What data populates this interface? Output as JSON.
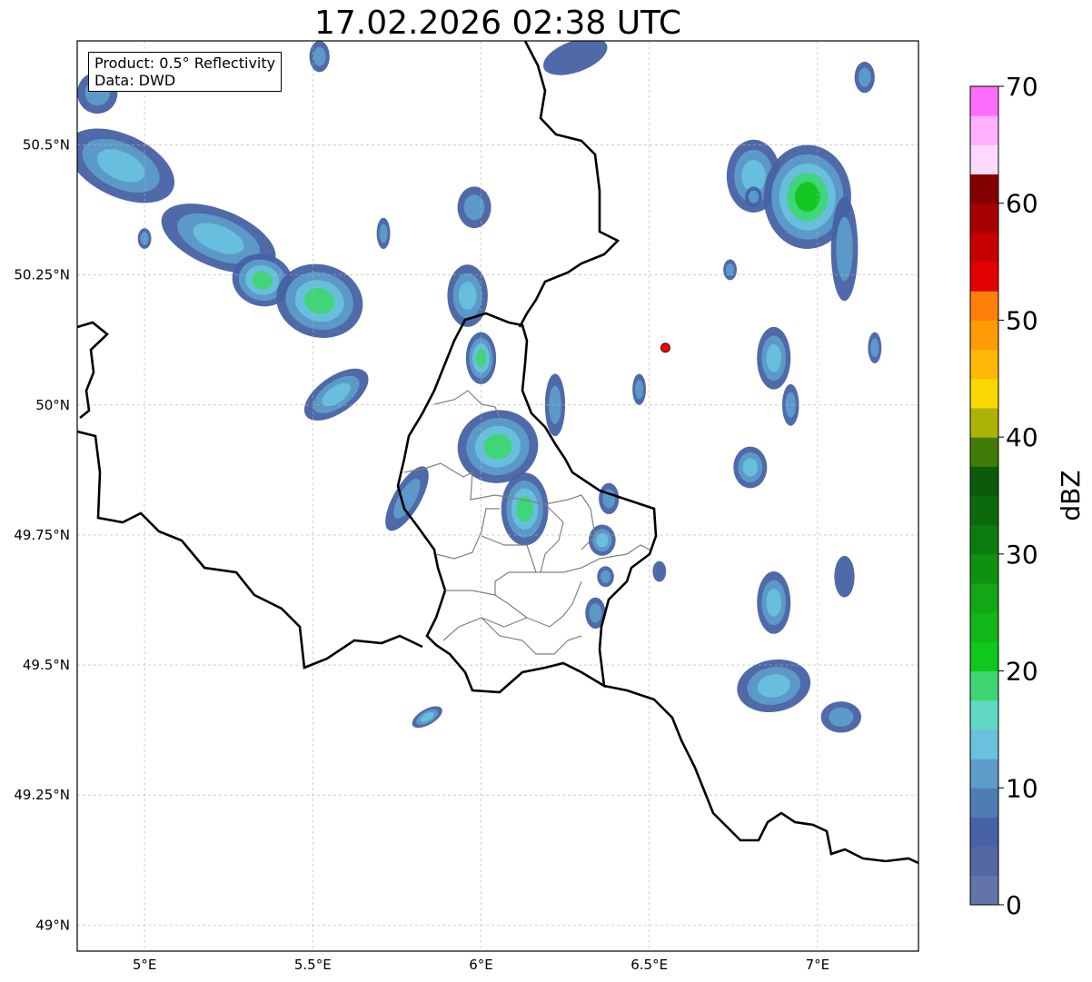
{
  "title": "17.02.2026 02:38 UTC",
  "info_box": {
    "product": "Product: 0.5° Reflectivity",
    "data": "Data: DWD"
  },
  "map": {
    "lon_range": [
      4.8,
      7.3
    ],
    "lat_range": [
      48.95,
      50.7
    ],
    "lon_ticks": [
      {
        "value": 5.0,
        "label": "5°E"
      },
      {
        "value": 5.5,
        "label": "5.5°E"
      },
      {
        "value": 6.0,
        "label": "6°E"
      },
      {
        "value": 6.5,
        "label": "6.5°E"
      },
      {
        "value": 7.0,
        "label": "7°E"
      }
    ],
    "lat_ticks": [
      {
        "value": 50.5,
        "label": "50.5°N"
      },
      {
        "value": 50.25,
        "label": "50.25°N"
      },
      {
        "value": 50.0,
        "label": "50°N"
      },
      {
        "value": 49.75,
        "label": "49.75°N"
      },
      {
        "value": 49.5,
        "label": "49.5°N"
      },
      {
        "value": 49.25,
        "label": "49.25°N"
      },
      {
        "value": 49.0,
        "label": "49°N"
      }
    ],
    "gridlines": true,
    "radar_site": {
      "lon": 6.548,
      "lat": 50.11,
      "color": "#ff0000"
    },
    "precip_cells": [
      {
        "lon": 4.93,
        "lat": 50.46,
        "rx": 0.17,
        "ry": 0.06,
        "rot": 25,
        "dbz": 14
      },
      {
        "lon": 5.22,
        "lat": 50.32,
        "rx": 0.18,
        "ry": 0.055,
        "rot": 22,
        "dbz": 15
      },
      {
        "lon": 5.35,
        "lat": 50.24,
        "rx": 0.09,
        "ry": 0.05,
        "rot": 15,
        "dbz": 19
      },
      {
        "lon": 5.52,
        "lat": 50.2,
        "rx": 0.13,
        "ry": 0.07,
        "rot": 15,
        "dbz": 20
      },
      {
        "lon": 5.57,
        "lat": 50.02,
        "rx": 0.11,
        "ry": 0.035,
        "rot": -35,
        "dbz": 17
      },
      {
        "lon": 5.0,
        "lat": 50.32,
        "rx": 0.02,
        "ry": 0.02,
        "rot": 0,
        "dbz": 10
      },
      {
        "lon": 5.71,
        "lat": 50.33,
        "rx": 0.02,
        "ry": 0.03,
        "rot": 0,
        "dbz": 11
      },
      {
        "lon": 5.98,
        "lat": 50.38,
        "rx": 0.05,
        "ry": 0.04,
        "rot": 0,
        "dbz": 13
      },
      {
        "lon": 5.96,
        "lat": 50.21,
        "rx": 0.06,
        "ry": 0.06,
        "rot": 0,
        "dbz": 15
      },
      {
        "lon": 6.0,
        "lat": 50.09,
        "rx": 0.045,
        "ry": 0.05,
        "rot": 0,
        "dbz": 21
      },
      {
        "lon": 6.05,
        "lat": 49.92,
        "rx": 0.12,
        "ry": 0.07,
        "rot": -10,
        "dbz": 19
      },
      {
        "lon": 6.13,
        "lat": 49.8,
        "rx": 0.07,
        "ry": 0.07,
        "rot": 0,
        "dbz": 20
      },
      {
        "lon": 5.78,
        "lat": 49.82,
        "rx": 0.04,
        "ry": 0.07,
        "rot": 30,
        "dbz": 10
      },
      {
        "lon": 6.22,
        "lat": 50.0,
        "rx": 0.03,
        "ry": 0.06,
        "rot": 0,
        "dbz": 11
      },
      {
        "lon": 6.38,
        "lat": 49.82,
        "rx": 0.03,
        "ry": 0.03,
        "rot": 0,
        "dbz": 12
      },
      {
        "lon": 6.36,
        "lat": 49.74,
        "rx": 0.04,
        "ry": 0.03,
        "rot": 0,
        "dbz": 16
      },
      {
        "lon": 6.34,
        "lat": 49.6,
        "rx": 0.03,
        "ry": 0.03,
        "rot": 0,
        "dbz": 10
      },
      {
        "lon": 6.37,
        "lat": 49.67,
        "rx": 0.025,
        "ry": 0.02,
        "rot": 0,
        "dbz": 10
      },
      {
        "lon": 6.28,
        "lat": 50.67,
        "rx": 0.1,
        "ry": 0.03,
        "rot": -20,
        "dbz": 9
      },
      {
        "lon": 5.52,
        "lat": 50.67,
        "rx": 0.03,
        "ry": 0.03,
        "rot": 0,
        "dbz": 10
      },
      {
        "lon": 6.81,
        "lat": 50.44,
        "rx": 0.08,
        "ry": 0.07,
        "rot": 0,
        "dbz": 15
      },
      {
        "lon": 6.97,
        "lat": 50.4,
        "rx": 0.13,
        "ry": 0.1,
        "rot": 0,
        "dbz": 24
      },
      {
        "lon": 7.08,
        "lat": 50.3,
        "rx": 0.04,
        "ry": 0.1,
        "rot": 0,
        "dbz": 12
      },
      {
        "lon": 6.87,
        "lat": 50.09,
        "rx": 0.05,
        "ry": 0.06,
        "rot": 0,
        "dbz": 16
      },
      {
        "lon": 6.92,
        "lat": 50.0,
        "rx": 0.025,
        "ry": 0.04,
        "rot": 0,
        "dbz": 10
      },
      {
        "lon": 6.8,
        "lat": 49.88,
        "rx": 0.05,
        "ry": 0.04,
        "rot": 0,
        "dbz": 16
      },
      {
        "lon": 6.87,
        "lat": 49.62,
        "rx": 0.05,
        "ry": 0.06,
        "rot": 0,
        "dbz": 14
      },
      {
        "lon": 6.87,
        "lat": 49.46,
        "rx": 0.11,
        "ry": 0.05,
        "rot": -10,
        "dbz": 15
      },
      {
        "lon": 7.07,
        "lat": 49.4,
        "rx": 0.06,
        "ry": 0.03,
        "rot": 0,
        "dbz": 10
      },
      {
        "lon": 7.08,
        "lat": 49.67,
        "rx": 0.03,
        "ry": 0.04,
        "rot": 0,
        "dbz": 9
      },
      {
        "lon": 6.74,
        "lat": 50.26,
        "rx": 0.02,
        "ry": 0.02,
        "rot": 0,
        "dbz": 10
      },
      {
        "lon": 6.81,
        "lat": 50.4,
        "rx": 0.025,
        "ry": 0.02,
        "rot": 0,
        "dbz": 10
      },
      {
        "lon": 6.47,
        "lat": 50.03,
        "rx": 0.02,
        "ry": 0.03,
        "rot": 0,
        "dbz": 10
      },
      {
        "lon": 5.84,
        "lat": 49.4,
        "rx": 0.05,
        "ry": 0.015,
        "rot": -30,
        "dbz": 14
      },
      {
        "lon": 7.17,
        "lat": 50.11,
        "rx": 0.02,
        "ry": 0.03,
        "rot": 0,
        "dbz": 10
      },
      {
        "lon": 7.14,
        "lat": 50.63,
        "rx": 0.03,
        "ry": 0.03,
        "rot": 0,
        "dbz": 10
      },
      {
        "lon": 4.86,
        "lat": 50.6,
        "rx": 0.06,
        "ry": 0.04,
        "rot": 0,
        "dbz": 10
      },
      {
        "lon": 6.53,
        "lat": 49.68,
        "rx": 0.02,
        "ry": 0.02,
        "rot": 0,
        "dbz": 9
      }
    ]
  },
  "colorbar": {
    "label": "dBZ",
    "min": 0,
    "max": 70,
    "step": 2.5,
    "ticks": [
      "0",
      "10",
      "20",
      "30",
      "40",
      "50",
      "60",
      "70"
    ],
    "colors": [
      "#6374a8",
      "#5467a0",
      "#4761a4",
      "#4f7cb5",
      "#5c9dc9",
      "#69c1de",
      "#61d8c3",
      "#3ed672",
      "#10c71b",
      "#13b618",
      "#12a717",
      "#0f910f",
      "#0d7c0e",
      "#0b6a0b",
      "#0b5b0a",
      "#437b08",
      "#adb208",
      "#fad702",
      "#ffb906",
      "#fe9b05",
      "#fe800a",
      "#e20002",
      "#c70001",
      "#a70000",
      "#840000",
      "#fdd9fd",
      "#fdb1fd",
      "#fd6efd",
      "#e63be7"
    ]
  }
}
